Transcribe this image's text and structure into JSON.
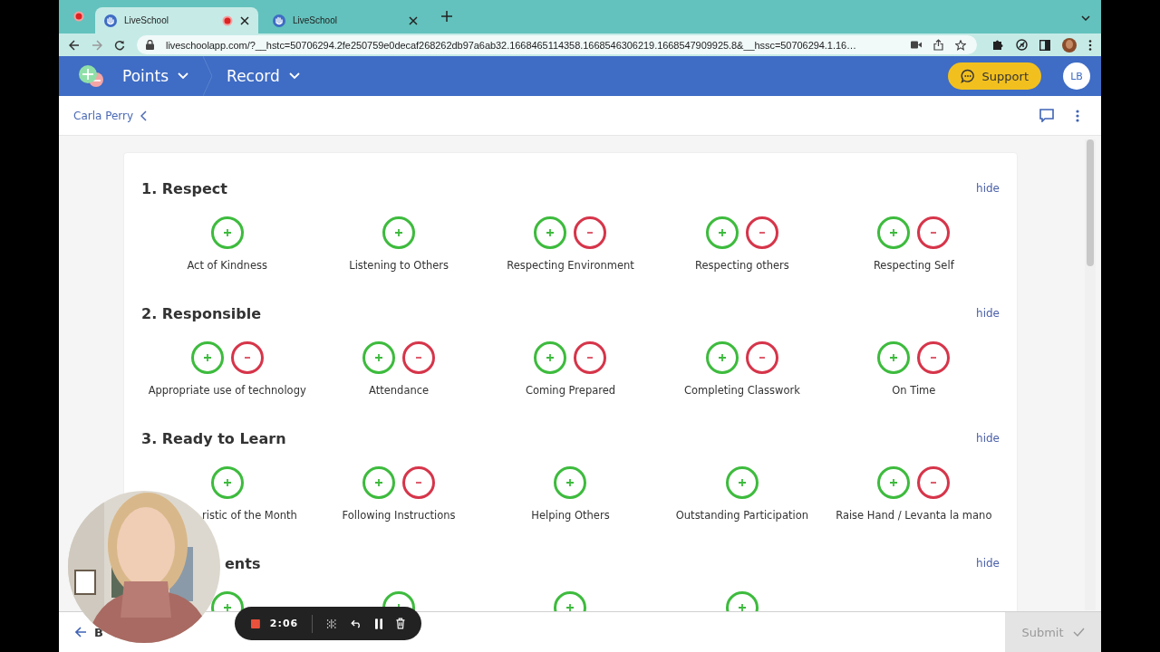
{
  "browser": {
    "tabs": [
      {
        "title": "LiveSchool",
        "selected": true,
        "recording": true
      },
      {
        "title": "LiveSchool",
        "selected": false,
        "recording": false
      }
    ],
    "url": "liveschoolapp.com/?__hstc=50706294.2fe250759e0decaf268262db97a6ab32.1668465114358.1668546306219.1668547909925.8&__hssc=50706294.1.16…"
  },
  "header": {
    "menus": [
      {
        "label": "Points"
      },
      {
        "label": "Record"
      }
    ],
    "support": "Support",
    "avatar": "LB"
  },
  "student": {
    "name": "Carla Perry"
  },
  "sections": [
    {
      "title": "1. Respect",
      "hide": "hide",
      "items": [
        {
          "label": "Act of Kindness",
          "minus": false
        },
        {
          "label": "Listening to Others",
          "minus": false
        },
        {
          "label": "Respecting Environment",
          "minus": true
        },
        {
          "label": "Respecting others",
          "minus": true
        },
        {
          "label": "Respecting Self",
          "minus": true
        }
      ]
    },
    {
      "title": "2. Responsible",
      "hide": "hide",
      "items": [
        {
          "label": "Appropriate use of technology",
          "minus": true
        },
        {
          "label": "Attendance",
          "minus": true
        },
        {
          "label": "Coming Prepared",
          "minus": true
        },
        {
          "label": "Completing Classwork",
          "minus": true
        },
        {
          "label": "On Time",
          "minus": true
        }
      ]
    },
    {
      "title": "3. Ready to Learn",
      "hide": "hide",
      "items": [
        {
          "label": "ristic of the Month",
          "minus": false,
          "cut_left": true
        },
        {
          "label": "Following Instructions",
          "minus": true
        },
        {
          "label": "Helping Others",
          "minus": false
        },
        {
          "label": "Outstanding Participation",
          "minus": false
        },
        {
          "label": "Raise Hand / Levanta la mano",
          "minus": true
        }
      ]
    },
    {
      "title": "ents",
      "cut_left": true,
      "hide": "hide",
      "items": [
        {
          "minus": false
        },
        {
          "minus": false
        },
        {
          "minus": false
        },
        {
          "minus": false
        }
      ]
    }
  ],
  "footer": {
    "back": "B",
    "submit": "Submit",
    "submit_disabled": true
  },
  "recorder": {
    "time": "2:06"
  }
}
